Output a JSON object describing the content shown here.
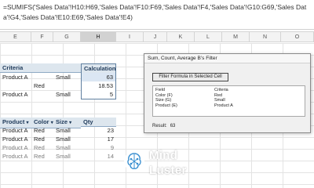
{
  "formula_bar": {
    "text": "=SUMIFS('Sales Data'!H10:H69,'Sales Data'!F10:F69,'Sales Data'!F4,'Sales Data'!G10:G69,'Sales Data'!G4,'Sales Data'!E10:E69,'Sales Data'!E4)"
  },
  "columns": [
    "E",
    "F",
    "G",
    "H",
    "I",
    "J",
    "K",
    "L",
    "M",
    "N",
    "O"
  ],
  "criteria": {
    "header": "Criteria",
    "rows": [
      [
        "Product A",
        "",
        "Small"
      ],
      [
        "",
        "Red",
        ""
      ],
      [
        "Product A",
        "",
        "Small"
      ]
    ]
  },
  "calculation": {
    "header": "Calculation",
    "values": [
      "63",
      "18.53",
      "5"
    ]
  },
  "table": {
    "headers": [
      "Product",
      "Color",
      "Size",
      "Qty"
    ],
    "rows": [
      [
        "Product A",
        "Red",
        "Small",
        "23"
      ],
      [
        "Product A",
        "Red",
        "Small",
        "17"
      ],
      [
        "Product A",
        "Red",
        "Small",
        "9"
      ],
      [
        "Product A",
        "Red",
        "Small",
        "14"
      ]
    ]
  },
  "dialog": {
    "title": "Sum, Count, Average B’s Filter",
    "button_label": "Filter Formula in Selected Cell",
    "field_header": "Field",
    "criteria_header": "Criteria",
    "fields": [
      "Color (F)",
      "Size (G)",
      "Product (E)"
    ],
    "criteria_values": [
      "Red",
      "Small",
      "Product A"
    ],
    "result_label": "Result:",
    "result_value": "63"
  },
  "logo": {
    "word1": "Mind",
    "word2": "Luster"
  }
}
